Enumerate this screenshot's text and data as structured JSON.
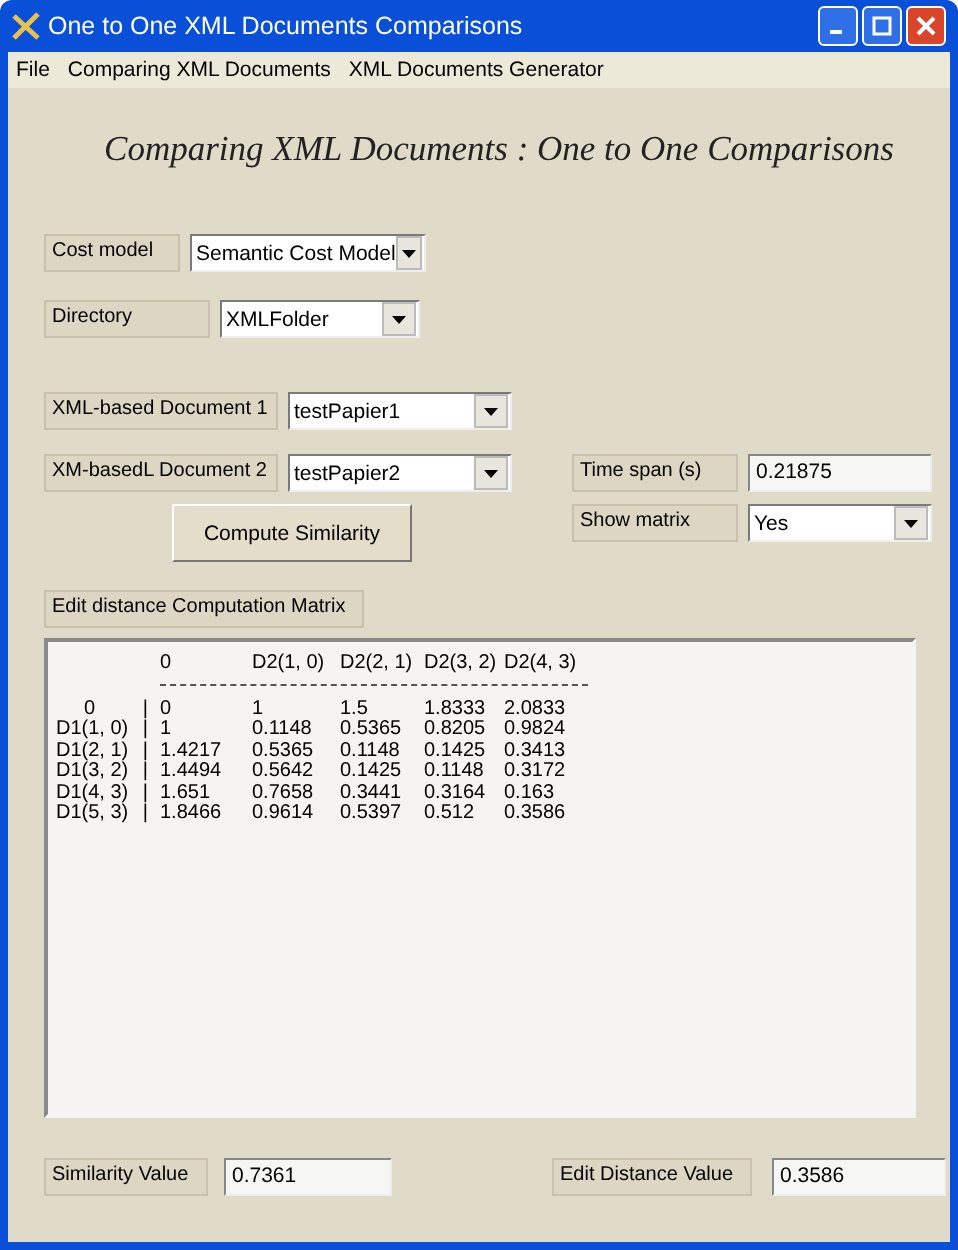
{
  "window": {
    "title": "One to One XML Documents Comparisons"
  },
  "menu": [
    "File",
    "Comparing XML Documents",
    "XML Documents Generator"
  ],
  "heading": "Comparing XML Documents : One to One Comparisons",
  "cost_model": {
    "label": "Cost model",
    "value": "Semantic Cost Model"
  },
  "directory": {
    "label": "Directory",
    "value": "XMLFolder"
  },
  "document_1": {
    "label": "XML-based Document 1",
    "value": "testPapier1"
  },
  "document_2": {
    "label": "XM-basedL Document 2",
    "value": "testPapier2"
  },
  "time_span": {
    "label": "Time span (s)",
    "value": "0.21875"
  },
  "show_matrix": {
    "label": "Show matrix",
    "value": "Yes"
  },
  "compute_button": "Compute Similarity",
  "matrix": {
    "label": "Edit distance Computation Matrix",
    "columns": [
      "0",
      "D2(1, 0)",
      "D2(2, 1)",
      "D2(3, 2)",
      "D2(4, 3)"
    ],
    "rows": [
      {
        "label": "0",
        "separator": "|",
        "values": [
          "0",
          "1",
          "1.5",
          "1.8333",
          "2.0833"
        ]
      },
      {
        "label": "D1(1, 0)",
        "separator": "|",
        "values": [
          "1",
          "0.1148",
          "0.5365",
          "0.8205",
          "0.9824"
        ]
      },
      {
        "label": "D1(2, 1)",
        "separator": "|",
        "values": [
          "1.4217",
          "0.5365",
          "0.1148",
          "0.1425",
          "0.3413"
        ]
      },
      {
        "label": "D1(3, 2)",
        "separator": "|",
        "values": [
          "1.4494",
          "0.5642",
          "0.1425",
          "0.1148",
          "0.3172"
        ]
      },
      {
        "label": "D1(4, 3)",
        "separator": "|",
        "values": [
          "1.651",
          "0.7658",
          "0.3441",
          "0.3164",
          "0.163"
        ]
      },
      {
        "label": "D1(5, 3)",
        "separator": "|",
        "values": [
          "1.8466",
          "0.9614",
          "0.5397",
          "0.512",
          "0.3586"
        ]
      }
    ]
  },
  "similarity": {
    "label": "Similarity Value",
    "value": "0.7361"
  },
  "edit_distance": {
    "label": "Edit Distance Value",
    "value": "0.3586"
  }
}
